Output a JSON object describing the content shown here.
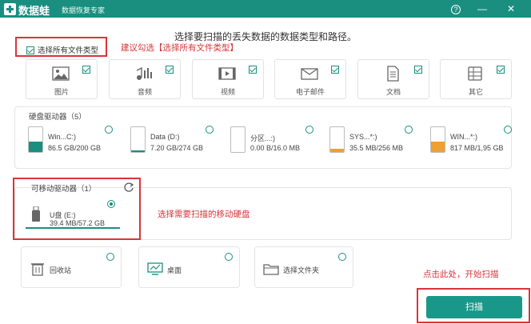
{
  "titlebar": {
    "app_name": "数据蛙",
    "app_subtitle": "数据恢复专家",
    "help": "?",
    "minimize": "—",
    "close": "✕"
  },
  "heading": "选择要扫描的丢失数据的数据类型和路径。",
  "select_all": {
    "label": "选择所有文件类型",
    "checked": true
  },
  "file_types": [
    {
      "label": "图片",
      "icon": "image-icon",
      "checked": true
    },
    {
      "label": "音频",
      "icon": "audio-icon",
      "checked": true
    },
    {
      "label": "视频",
      "icon": "video-icon",
      "checked": true
    },
    {
      "label": "电子邮件",
      "icon": "email-icon",
      "checked": true
    },
    {
      "label": "文档",
      "icon": "document-icon",
      "checked": true
    },
    {
      "label": "其它",
      "icon": "other-icon",
      "checked": true
    }
  ],
  "hard_drives": {
    "title": "硬盘驱动器（5）",
    "items": [
      {
        "name": "Win...C:)",
        "size": "86.5 GB/200 GB",
        "usage": 0.43,
        "fill": "#1a8f80"
      },
      {
        "name": "Data (D:)",
        "size": "7.20 GB/274 GB",
        "usage": 0.03,
        "fill": "#1a8f80"
      },
      {
        "name": "分区...:)",
        "size": "0.00  B/16.0 MB",
        "usage": 0.0,
        "fill": "#f0a030"
      },
      {
        "name": "SYS...*:)",
        "size": "35.5 MB/256 MB",
        "usage": 0.14,
        "fill": "#f0a030"
      },
      {
        "name": "WIN...*:)",
        "size": "817 MB/1,95 GB",
        "usage": 0.42,
        "fill": "#f0a030"
      }
    ]
  },
  "removable": {
    "title": "可移动驱动器（1）",
    "refresh_icon": "refresh-icon",
    "items": [
      {
        "name": "U盘 (E:)",
        "size": "39.4 MB/57.2 GB",
        "selected": true
      }
    ]
  },
  "locations": [
    {
      "label": "回收站",
      "icon": "recycle-bin-icon"
    },
    {
      "label": "桌面",
      "icon": "desktop-icon"
    },
    {
      "label": "选择文件夹",
      "icon": "folder-icon"
    }
  ],
  "notes": {
    "select_all_hint": "建议勾选【选择所有文件类型】",
    "removable_hint": "选择需要扫描的移动硬盘",
    "scan_hint": "点击此处，开始扫描"
  },
  "scan_button": "扫描",
  "colors": {
    "accent": "#1a8f80",
    "annotation": "#d8343a",
    "warning": "#f0a030"
  }
}
